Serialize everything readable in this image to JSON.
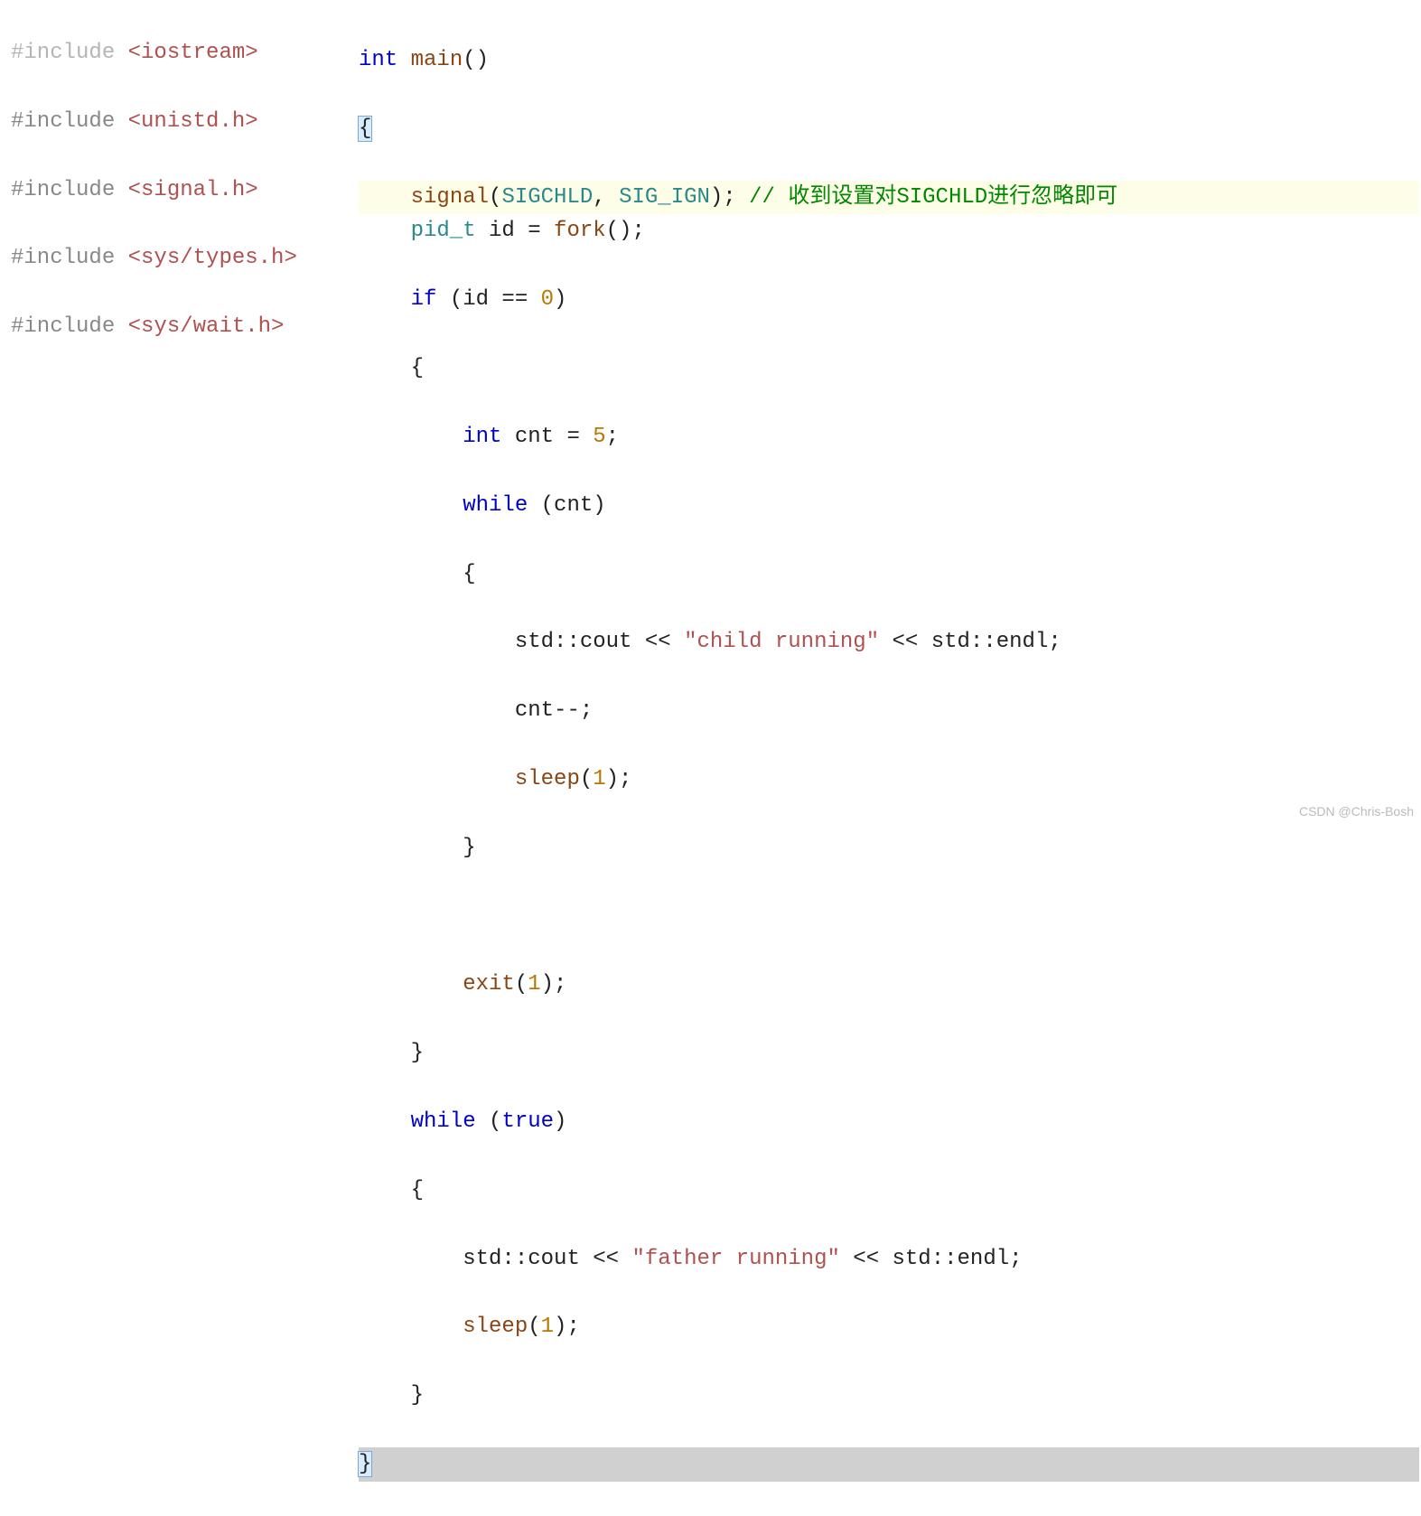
{
  "left": {
    "inc1a": "#include",
    "inc1b": "<iostream>",
    "inc2a": "#include",
    "inc2b": "<unistd.h>",
    "inc3a": "#include",
    "inc3b": "<signal.h>",
    "inc4a": "#include",
    "inc4b": "<sys/types.h>",
    "inc5a": "#include",
    "inc5b": "<sys/wait.h>"
  },
  "right": {
    "main_kw": "int",
    "main_fn": "main",
    "main_paren": "()",
    "brace_open": "{",
    "signal_fn": "signal",
    "lparen": "(",
    "sigchld": "SIGCHLD",
    "comma_sp": ", ",
    "sig_ign": "SIG_IGN",
    "rparen_sc": "); ",
    "comment_slash": "// ",
    "comment_txt": "收到设置对SIGCHLD进行忽略即可",
    "pid_t": "pid_t",
    "id_decl": " id = ",
    "fork": "fork",
    "paren_sc": "();",
    "if_kw": "if",
    "if_cond_open": " (id == ",
    "zero": "0",
    "cond_close": ")",
    "brace2": "{",
    "int_kw": "int",
    "cnt_decl": " cnt = ",
    "five": "5",
    "sc": ";",
    "while_kw": "while",
    "while_cond": " (cnt)",
    "brace3": "{",
    "cout1a": "std::cout << ",
    "str_child": "\"child running\"",
    "cout1b": " << std::endl;",
    "cnt_dec": "cnt--;",
    "sleep_fn": "sleep",
    "sleep_arg_open": "(",
    "one": "1",
    "sleep_arg_close": ");",
    "brace3_close": "}",
    "exit_fn": "exit",
    "brace2_close": "}",
    "while_kw2": "while",
    "true_cond_open": " (",
    "true_kw": "true",
    "true_cond_close": ")",
    "brace4": "{",
    "str_father": "\"father running\"",
    "brace4_close": "}",
    "brace_close": "}"
  },
  "watermark": "CSDN @Chris-Bosh"
}
